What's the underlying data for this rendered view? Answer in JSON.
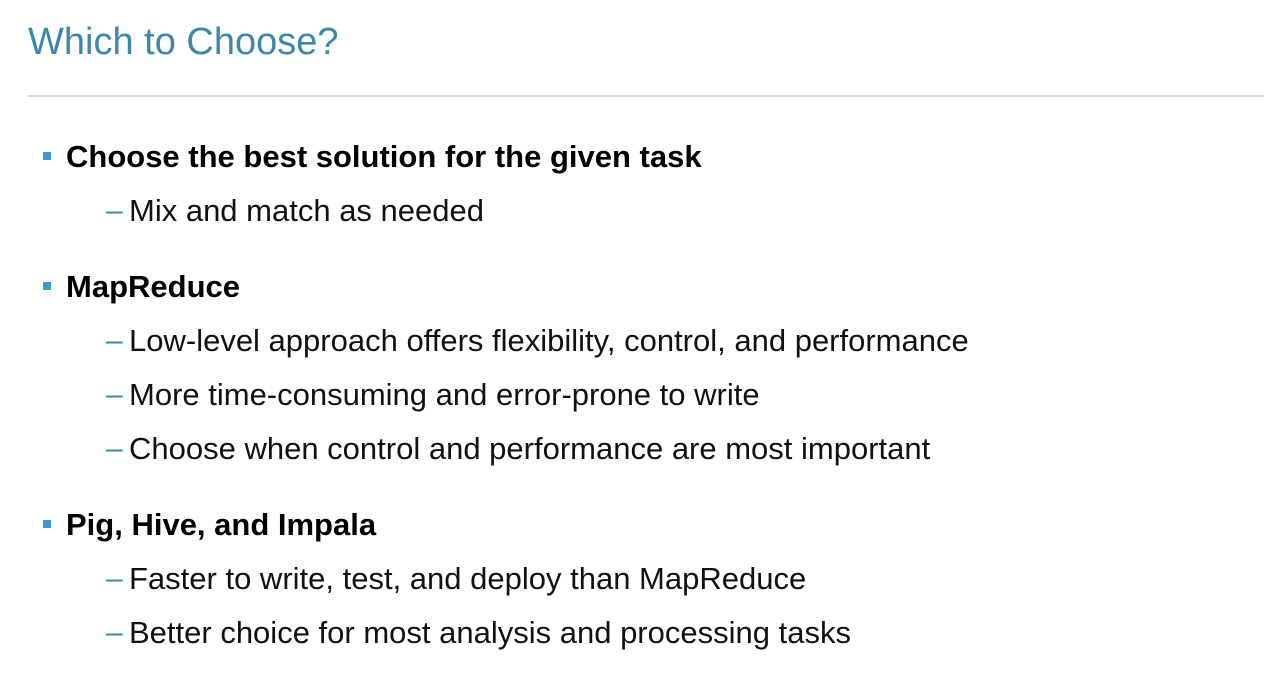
{
  "slide": {
    "title": "Which to Choose?",
    "colors": {
      "title": "#3d87a9",
      "rule": "#d8d8d8",
      "bullet": "#3d9ad1",
      "dash": "#3d87a9",
      "text": "#000000"
    },
    "bullets": [
      {
        "label": "Choose the best solution for the given task",
        "subitems": [
          {
            "dash": "–",
            "text": "Mix and match as needed"
          }
        ]
      },
      {
        "label": "MapReduce",
        "subitems": [
          {
            "dash": "–",
            "text": "Low-level approach offers flexibility, control, and performance"
          },
          {
            "dash": "–",
            "text": "More time-consuming and error-prone to write"
          },
          {
            "dash": "–",
            "text": "Choose when control and performance are most important"
          }
        ]
      },
      {
        "label": "Pig, Hive, and Impala",
        "subitems": [
          {
            "dash": "–",
            "text": "Faster to write, test, and deploy than MapReduce"
          },
          {
            "dash": "–",
            "text": "Better choice for most analysis and processing tasks"
          }
        ]
      }
    ]
  }
}
